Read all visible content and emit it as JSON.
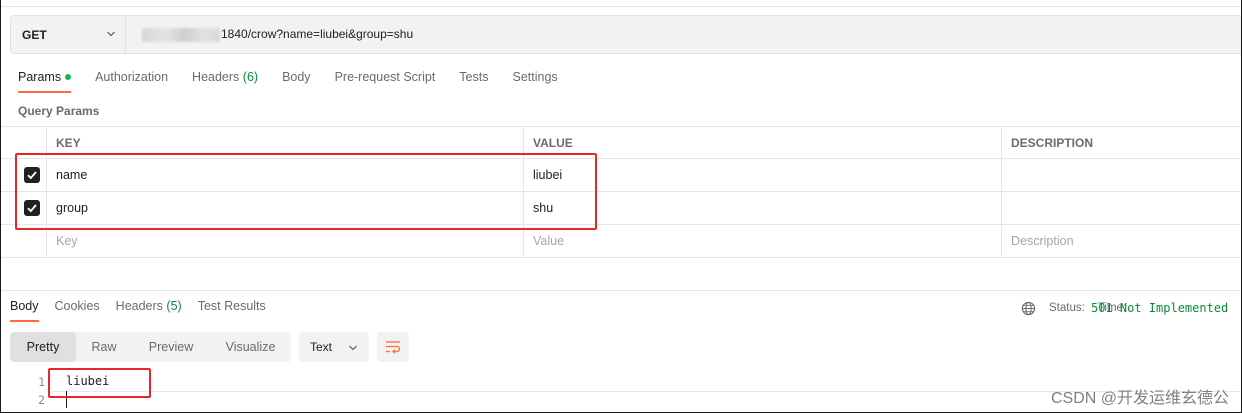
{
  "request": {
    "method": "GET",
    "url_suffix": "1840/crow?name=liubei&group=shu"
  },
  "request_tabs": [
    {
      "label": "Params",
      "active": true,
      "dot": true
    },
    {
      "label": "Authorization"
    },
    {
      "label": "Headers",
      "count": "(6)"
    },
    {
      "label": "Body"
    },
    {
      "label": "Pre-request Script"
    },
    {
      "label": "Tests"
    },
    {
      "label": "Settings"
    }
  ],
  "query_params": {
    "label": "Query Params",
    "columns": {
      "key": "KEY",
      "value": "VALUE",
      "description": "DESCRIPTION"
    },
    "rows": [
      {
        "key": "name",
        "value": "liubei",
        "checked": true
      },
      {
        "key": "group",
        "value": "shu",
        "checked": true
      }
    ],
    "placeholders": {
      "key": "Key",
      "value": "Value",
      "description": "Description"
    }
  },
  "response_tabs": [
    {
      "label": "Body",
      "active": true
    },
    {
      "label": "Cookies"
    },
    {
      "label": "Headers",
      "count": "(5)"
    },
    {
      "label": "Test Results"
    }
  ],
  "status": {
    "label": "Status:",
    "code": "501 Not Implemented",
    "time_label": "Time:"
  },
  "view_modes": [
    "Pretty",
    "Raw",
    "Preview",
    "Visualize"
  ],
  "selected_view": "Pretty",
  "format": "Text",
  "response_body": {
    "lines": [
      {
        "num": "1",
        "text": "liubei"
      },
      {
        "num": "2",
        "text": ""
      }
    ]
  },
  "watermark": "CSDN @开发运维玄德公",
  "colors": {
    "accent": "#ff6c37",
    "highlight_box": "#e8262a",
    "status_ok": "#0e8a3e",
    "params_dot": "#0cbb52"
  },
  "icons": {
    "method_dropdown": "chevron-down-icon",
    "status": "globe-icon",
    "wrap": "wrap-lines-icon",
    "checkbox": "checkmark-icon"
  }
}
